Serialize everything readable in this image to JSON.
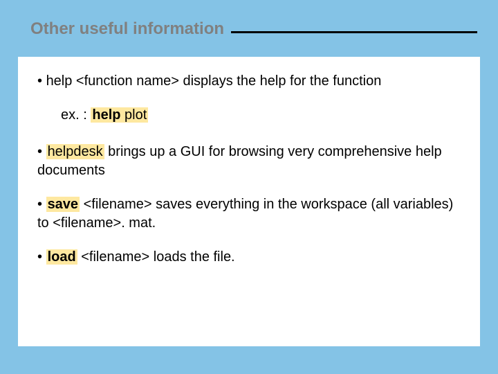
{
  "title": "Other useful information",
  "bullets": {
    "b1": {
      "prefix": "• ",
      "cmd": "help",
      "arg": " <function name> ",
      "rest": "displays the help for the function"
    },
    "example": {
      "prefix": "ex. : ",
      "cmd": "help",
      "arg": " plot"
    },
    "b2": {
      "prefix": "• ",
      "cmd": "helpdesk",
      "rest": " brings up a GUI for browsing very comprehensive help documents"
    },
    "b3": {
      "prefix": "• ",
      "cmd": "save",
      "arg": " <filename> ",
      "rest": "saves everything in the workspace (all variables) to <filename>. mat."
    },
    "b4": {
      "prefix": "• ",
      "cmd": "load",
      "arg": " <filename> ",
      "rest": "loads the file."
    }
  }
}
